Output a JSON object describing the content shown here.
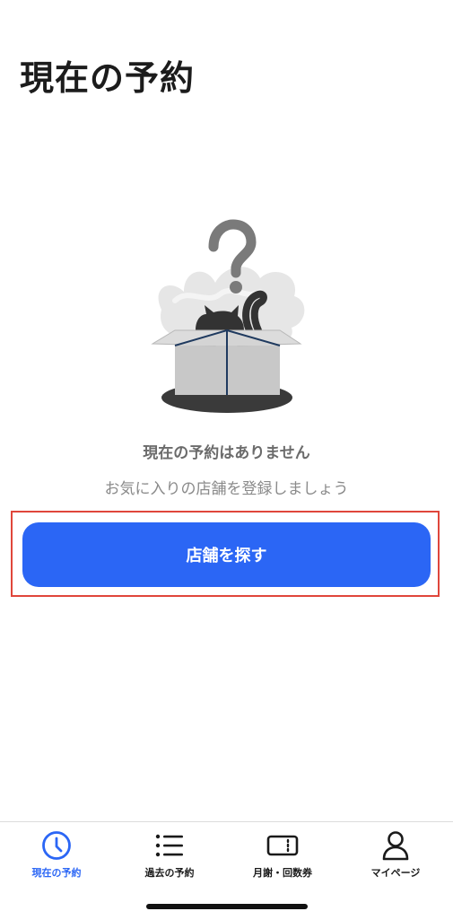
{
  "page": {
    "title": "現在の予約"
  },
  "empty_state": {
    "illustration": "cat-in-box-question-illustration",
    "title": "現在の予約はありません",
    "subtitle": "お気に入りの店舗を登録しましょう"
  },
  "actions": {
    "find_store_label": "店舗を探す"
  },
  "tab_bar": {
    "active_color": "#2b66f5",
    "items": [
      {
        "label": "現在の予約",
        "icon": "clock-icon",
        "active": true
      },
      {
        "label": "過去の予約",
        "icon": "list-icon",
        "active": false
      },
      {
        "label": "月謝・回数券",
        "icon": "ticket-icon",
        "active": false
      },
      {
        "label": "マイページ",
        "icon": "person-icon",
        "active": false
      }
    ]
  },
  "colors": {
    "accent": "#2b66f5",
    "highlight_border": "#e0463b"
  }
}
